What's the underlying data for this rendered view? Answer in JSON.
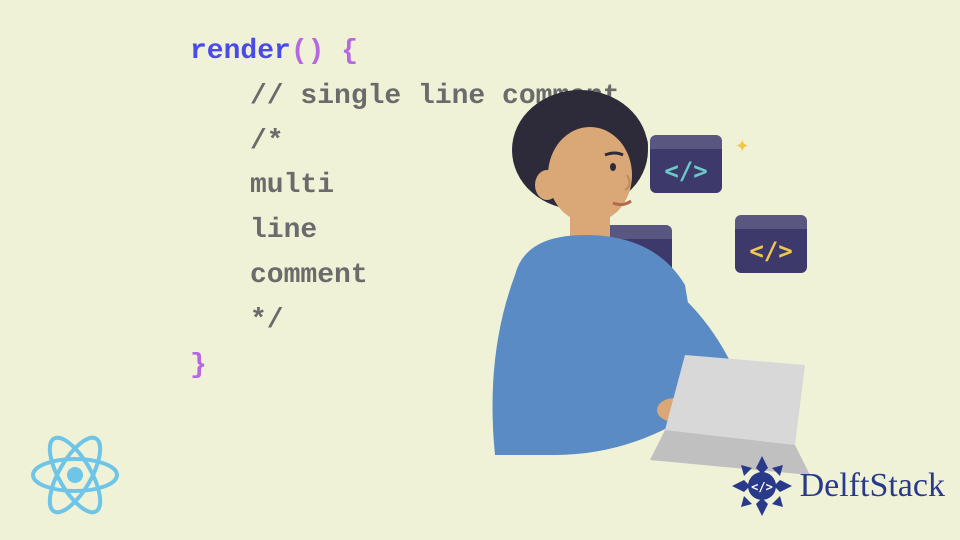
{
  "code": {
    "line1_render": "render",
    "line1_parens": "()",
    "line1_brace": " {",
    "line2": "// single line comment",
    "line3": "/*",
    "line4": "multi",
    "line5": "line",
    "line6": "comment",
    "line7": "*/",
    "line8": "}"
  },
  "logos": {
    "delft_text": "DelftStack"
  },
  "icons": {
    "code_glyph": "</>"
  }
}
